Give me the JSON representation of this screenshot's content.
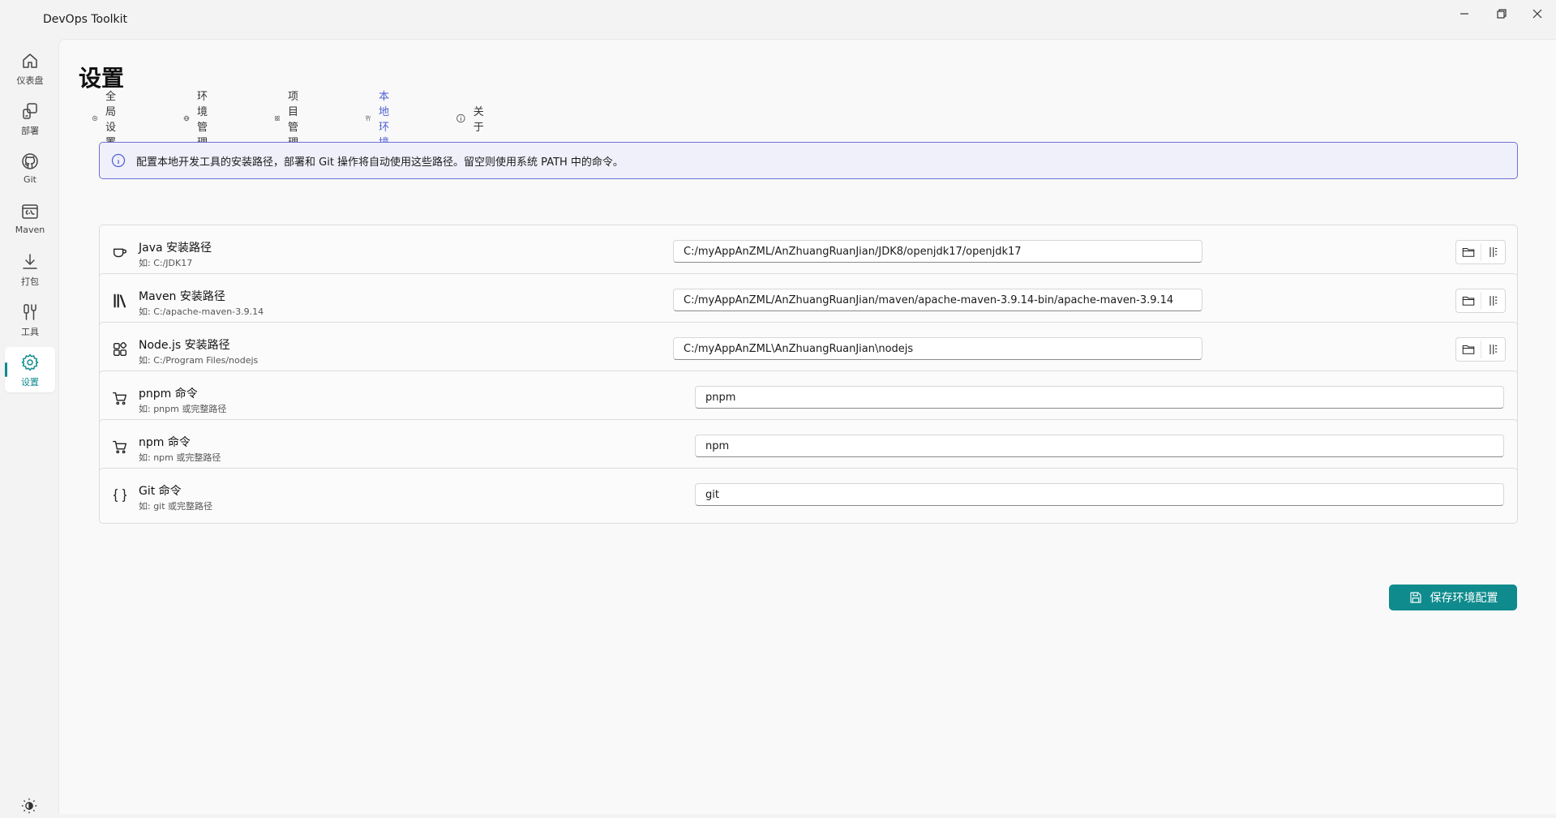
{
  "window": {
    "title": "DevOps Toolkit",
    "controls": [
      "minimize-icon",
      "restore-icon",
      "close-icon"
    ]
  },
  "sidebar": {
    "items": [
      {
        "label": "仪表盘",
        "icon": "home-icon",
        "active": false
      },
      {
        "label": "部署",
        "icon": "deploy-icon",
        "active": false
      },
      {
        "label": "Git",
        "icon": "github-icon",
        "active": false
      },
      {
        "label": "Maven",
        "icon": "terminal-icon",
        "active": false
      },
      {
        "label": "打包",
        "icon": "download-icon",
        "active": false
      },
      {
        "label": "工具",
        "icon": "tools-icon",
        "active": false
      },
      {
        "label": "设置",
        "icon": "gear-icon",
        "active": true
      }
    ],
    "footer_icon": "theme-toggle-icon"
  },
  "page": {
    "title": "设置",
    "tabs": [
      {
        "label": "全局设置",
        "icon": "gear-icon",
        "active": false
      },
      {
        "label": "环境管理",
        "icon": "globe-icon",
        "active": false
      },
      {
        "label": "项目管理",
        "icon": "apps-icon",
        "active": false
      },
      {
        "label": "本地环境",
        "icon": "wrench-icon",
        "active": true
      },
      {
        "label": "关于",
        "icon": "info-icon",
        "active": false
      }
    ],
    "info": "配置本地开发工具的安装路径，部署和 Git 操作将自动使用这些路径。留空则使用系统 PATH 中的命令。"
  },
  "settings": [
    {
      "title": "Java 安装路径",
      "hint": "如: C:/JDK17",
      "value": "C:/myAppAnZML/AnZhuangRuanJian/JDK8/openjdk17/openjdk17",
      "icon": "coffee-icon",
      "has_browse": true
    },
    {
      "title": "Maven 安装路径",
      "hint": "如: C:/apache-maven-3.9.14",
      "value": "C:/myAppAnZML/AnZhuangRuanJian/maven/apache-maven-3.9.14-bin/apache-maven-3.9.14",
      "icon": "library-icon",
      "has_browse": true
    },
    {
      "title": "Node.js 安装路径",
      "hint": "如: C:/Program Files/nodejs",
      "value": "C:/myAppAnZML\\AnZhuangRuanJian\\nodejs",
      "icon": "apps-icon",
      "has_browse": true
    },
    {
      "title": "pnpm 命令",
      "hint": "如: pnpm 或完整路径",
      "value": "pnpm",
      "icon": "cart-icon",
      "has_browse": false
    },
    {
      "title": "npm 命令",
      "hint": "如: npm 或完整路径",
      "value": "npm",
      "icon": "cart-icon",
      "has_browse": false
    },
    {
      "title": "Git 命令",
      "hint": "如: git 或完整路径",
      "value": "git",
      "icon": "braces-icon",
      "has_browse": false
    }
  ],
  "save_button": {
    "label": "保存环境配置",
    "icon": "save-icon"
  },
  "colors": {
    "accent": "#0f8b8d",
    "info_border": "#6d72d6",
    "active_tab": "#4f5fd6"
  }
}
